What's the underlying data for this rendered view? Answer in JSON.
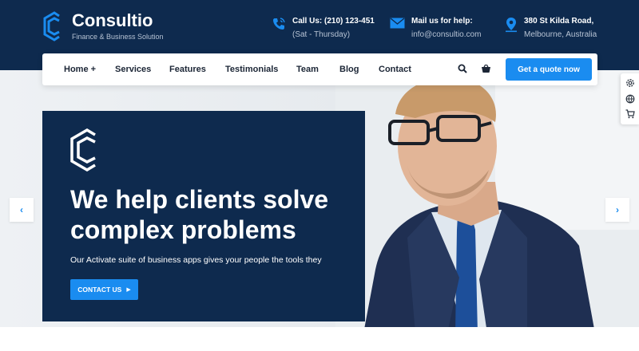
{
  "header": {
    "brand_name": "Consultio",
    "brand_tagline": "Finance & Business Solution",
    "phone": {
      "icon": "phone-icon",
      "line1": "Call Us: (210) 123-451",
      "line2": "(Sat - Thursday)"
    },
    "email": {
      "icon": "envelope-icon",
      "line1": "Mail us for help:",
      "line2": "info@consultio.com"
    },
    "address": {
      "icon": "map-pin-icon",
      "line1": "380 St Kilda Road,",
      "line2": "Melbourne, Australia"
    }
  },
  "nav": {
    "items": [
      {
        "label": "Home +"
      },
      {
        "label": "Services"
      },
      {
        "label": "Features"
      },
      {
        "label": "Testimonials"
      },
      {
        "label": "Team"
      },
      {
        "label": "Blog"
      },
      {
        "label": "Contact"
      }
    ],
    "search_icon": "search-icon",
    "cart_icon": "basket-icon",
    "quote_button": "Get a quote now"
  },
  "side_tools": [
    "settings-icon",
    "globe-icon",
    "cart-icon"
  ],
  "hero": {
    "headline_line1": "We help clients solve",
    "headline_line2": "complex problems",
    "subtext": "Our Activate suite of business apps gives your people the tools they",
    "cta_label": "CONTACT US",
    "prev_arrow": "‹",
    "next_arrow": "›"
  },
  "colors": {
    "navy": "#0e2a4e",
    "accent": "#1a8cf0",
    "white": "#ffffff"
  }
}
